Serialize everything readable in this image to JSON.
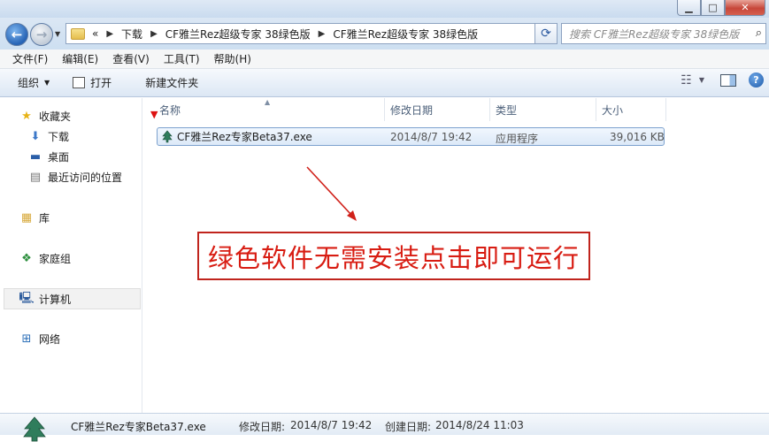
{
  "window": {
    "minimize_glyph": "▁",
    "maximize_glyph": "□",
    "close_glyph": "✕"
  },
  "address": {
    "overflow": "«",
    "crumbs": [
      "下载",
      "CF雅兰Rez超级专家 38绿色版",
      "CF雅兰Rez超级专家 38绿色版"
    ],
    "search_placeholder": "搜索 CF雅兰Rez超级专家 38绿色版"
  },
  "menu": [
    "文件(F)",
    "编辑(E)",
    "查看(V)",
    "工具(T)",
    "帮助(H)"
  ],
  "toolbar": {
    "organize": "组织",
    "open": "打开",
    "new_folder": "新建文件夹"
  },
  "nav": {
    "favorites": "收藏夹",
    "downloads": "下载",
    "desktop": "桌面",
    "recent": "最近访问的位置",
    "libraries": "库",
    "homegroup": "家庭组",
    "computer": "计算机",
    "network": "网络"
  },
  "columns": {
    "name": "名称",
    "modified": "修改日期",
    "type": "类型",
    "size": "大小"
  },
  "file": {
    "name": "CF雅兰Rez专家Beta37.exe",
    "modified": "2014/8/7 19:42",
    "type": "应用程序",
    "size": "39,016 KB"
  },
  "annotation": {
    "text": "绿色软件无需安装点击即可运行",
    "color": "#d81c12"
  },
  "status": {
    "filename": "CF雅兰Rez专家Beta37.exe",
    "modified_label": "修改日期:",
    "modified_value": "2014/8/7 19:42",
    "created_label": "创建日期:",
    "created_value": "2014/8/24 11:03"
  }
}
